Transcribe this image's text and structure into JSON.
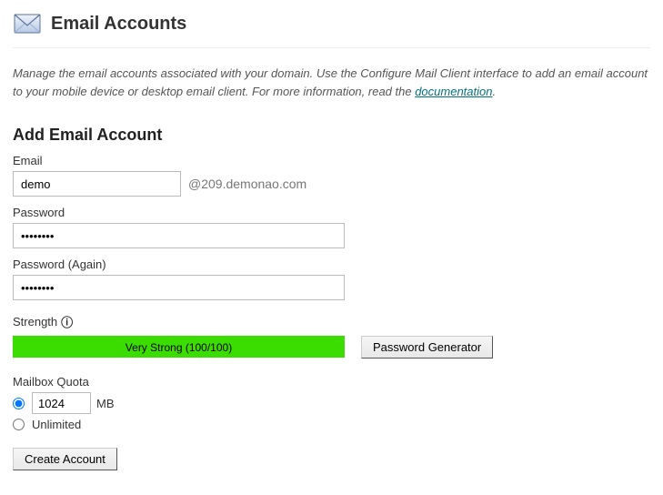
{
  "header": {
    "title": "Email Accounts"
  },
  "description": {
    "text_before": "Manage the email accounts associated with your domain. Use the Configure Mail Client interface to add an email account to your mobile device or desktop email client. For more information, read the ",
    "link_text": "documentation",
    "text_after": "."
  },
  "form": {
    "section_title": "Add Email Account",
    "email_label": "Email",
    "email_value": "demo",
    "domain_suffix": "@209.demonao.com",
    "password_label": "Password",
    "password_value": "••••••••",
    "password2_label": "Password (Again)",
    "password2_value": "••••••••",
    "strength_label": "Strength",
    "strength_text": "Very Strong (100/100)",
    "password_generator_label": "Password Generator",
    "quota_label": "Mailbox Quota",
    "quota_value": "1024",
    "quota_unit": "MB",
    "quota_unlimited_label": "Unlimited",
    "submit_label": "Create Account"
  }
}
